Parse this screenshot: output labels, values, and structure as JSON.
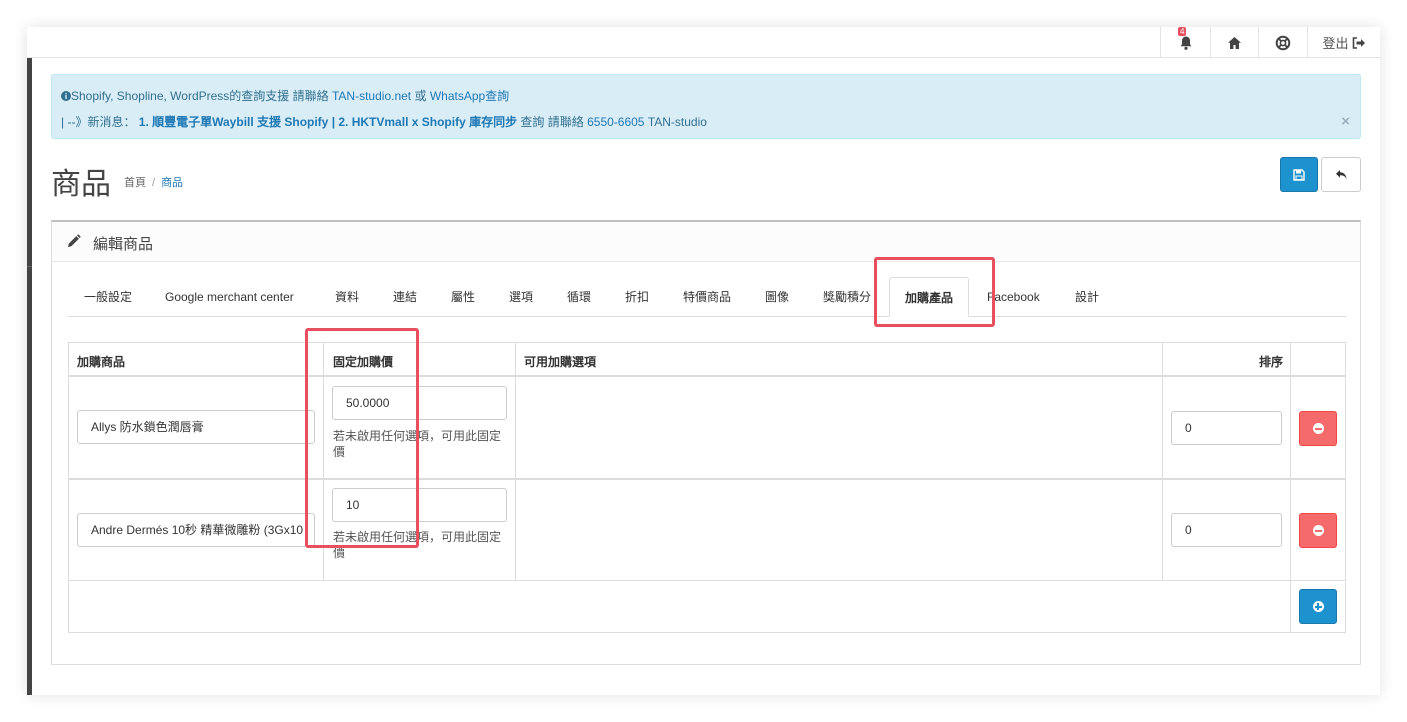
{
  "topbar": {
    "notification_badge": "4",
    "logout_label": "登出"
  },
  "alert": {
    "line1_prefix": "Shopify, Shopline, WordPress的查詢支援 請聯絡 ",
    "line1_link1": "TAN-studio.net",
    "line1_or": " 或 ",
    "line1_link2": "WhatsApp查詢",
    "line2_prefix": "| --》新消息：",
    "line2_news": " 1. 順豐電子單Waybill 支援 Shopify | 2. HKTVmall x Shopify 庫存同步",
    "line2_mid": " 查詢 請聯絡 ",
    "line2_phone": "6550-6605",
    "line2_suffix": " TAN-studio",
    "close_label": "×"
  },
  "header": {
    "title": "商品",
    "breadcrumb_home": "首頁",
    "breadcrumb_sep": "/",
    "breadcrumb_current": "商品"
  },
  "panel": {
    "title": "編輯商品",
    "tabs": [
      "一般設定",
      "Google merchant center",
      "資料",
      "連結",
      "屬性",
      "選項",
      "循環",
      "折扣",
      "特價商品",
      "圖像",
      "獎勵積分",
      "加購產品",
      "Facebook",
      "設計"
    ],
    "active_tab": "加購產品"
  },
  "table": {
    "headers": {
      "product": "加購商品",
      "fixed_price": "固定加購價",
      "options": "可用加購選項",
      "sort": "排序"
    },
    "rows": [
      {
        "product": "Allys 防水鎖色潤唇膏",
        "price": "50.0000",
        "help": "若未啟用任何選項，可用此固定價",
        "sort": "0"
      },
      {
        "product": "Andre Dermés 10秒 精華微雕粉 (3Gx10",
        "price": "10",
        "help": "若未啟用任何選項，可用此固定價",
        "sort": "0"
      }
    ]
  },
  "colors": {
    "primary": "#1e91cf",
    "danger": "#f56b6b",
    "alert_bg": "#d9edf7",
    "highlight": "#e8505f"
  }
}
